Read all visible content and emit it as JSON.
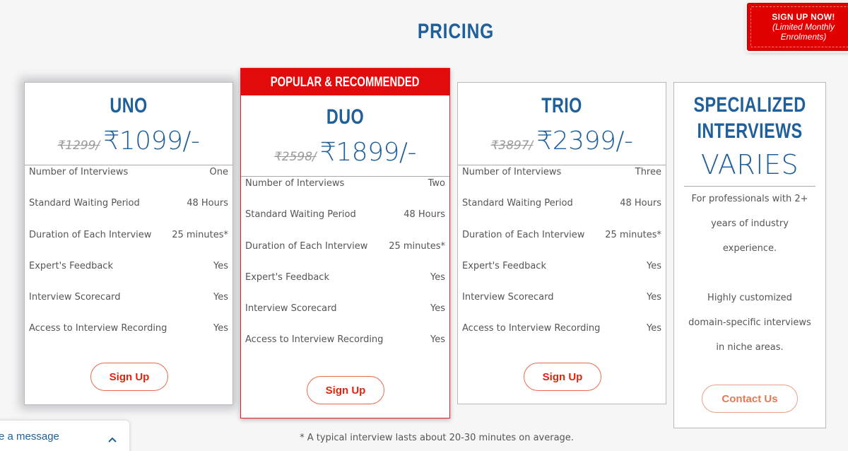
{
  "header": {
    "title": "PRICING"
  },
  "signup_banner": {
    "line1": "SIGN UP NOW!",
    "line2": "(Limited Monthly",
    "line3": "Enrolments)"
  },
  "plans": [
    {
      "name": "UNO",
      "old_price": "₹1299/",
      "price": "₹1099/-",
      "features": [
        {
          "label": "Number of Interviews",
          "value": "One"
        },
        {
          "label": "Standard Waiting Period",
          "value": "48 Hours"
        },
        {
          "label": "Duration of Each Interview",
          "value": "25 minutes*"
        },
        {
          "label": "Expert's Feedback",
          "value": "Yes"
        },
        {
          "label": "Interview Scorecard",
          "value": "Yes"
        },
        {
          "label": "Access to Interview Recording",
          "value": "Yes"
        }
      ],
      "button": "Sign Up"
    },
    {
      "badge": "POPULAR & RECOMMENDED",
      "name": "DUO",
      "old_price": "₹2598/",
      "price": "₹1899/-",
      "features": [
        {
          "label": "Number of Interviews",
          "value": "Two"
        },
        {
          "label": "Standard Waiting Period",
          "value": "48 Hours"
        },
        {
          "label": "Duration of Each Interview",
          "value": "25 minutes*"
        },
        {
          "label": "Expert's Feedback",
          "value": "Yes"
        },
        {
          "label": "Interview Scorecard",
          "value": "Yes"
        },
        {
          "label": "Access to Interview Recording",
          "value": "Yes"
        }
      ],
      "button": "Sign Up"
    },
    {
      "name": "TRIO",
      "old_price": "₹3897/",
      "price": "₹2399/-",
      "features": [
        {
          "label": "Number of Interviews",
          "value": "Three"
        },
        {
          "label": "Standard Waiting Period",
          "value": "48 Hours"
        },
        {
          "label": "Duration of Each Interview",
          "value": "25 minutes*"
        },
        {
          "label": "Expert's Feedback",
          "value": "Yes"
        },
        {
          "label": "Interview Scorecard",
          "value": "Yes"
        },
        {
          "label": "Access to Interview Recording",
          "value": "Yes"
        }
      ],
      "button": "Sign Up"
    }
  ],
  "specialized": {
    "name_line1": "SPECIALIZED",
    "name_line2": "INTERVIEWS",
    "price": "VARIES",
    "desc_lines": [
      "For professionals with 2+",
      "years of industry",
      "experience.",
      "",
      "Highly customized",
      "domain-specific interviews",
      "in niche areas."
    ],
    "button": "Contact Us"
  },
  "footnote": "* A typical interview lasts about 20-30 minutes on average.",
  "chat": {
    "label": "e a message",
    "icon": "chevron-up-icon"
  },
  "colors": {
    "brand_blue": "#1f5f9a",
    "accent_red": "#e20a0a",
    "button_text": "#e0250d"
  }
}
